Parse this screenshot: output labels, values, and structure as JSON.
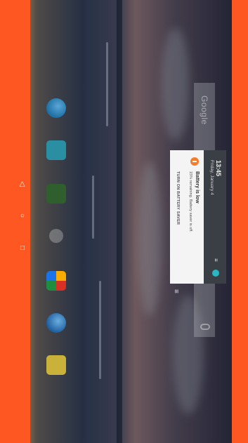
{
  "search": {
    "label": "Google"
  },
  "notification_shade": {
    "time": "13:45",
    "date": "Friday, January 4",
    "icons": [
      "tune-icon",
      "avatar-icon"
    ]
  },
  "notification": {
    "icon": "battery-icon",
    "title": "Battery is low",
    "text": "15% remaining. Battery saver is off.",
    "action": "TURN ON BATTERY SAVER",
    "accent": "#f57c2d"
  },
  "clear_all": {
    "icon": "clear-all-icon",
    "symbol": "≡"
  },
  "dock": {
    "apps": [
      {
        "name": "browser-app",
        "color": "#1d6fa3"
      },
      {
        "name": "camera-app",
        "color": "#2b8fa3"
      },
      {
        "name": "messaging-app",
        "color": "#3d8b3a"
      },
      {
        "name": "app-drawer"
      },
      {
        "name": "google-apps-folder",
        "color": "#c0392b"
      },
      {
        "name": "globe-app",
        "color": "#1f5e9e"
      },
      {
        "name": "folder-app",
        "color": "#c9b13a"
      }
    ]
  },
  "navbar": {
    "back": "◁",
    "home": "○",
    "recents": "□",
    "color": "#fe5722"
  }
}
